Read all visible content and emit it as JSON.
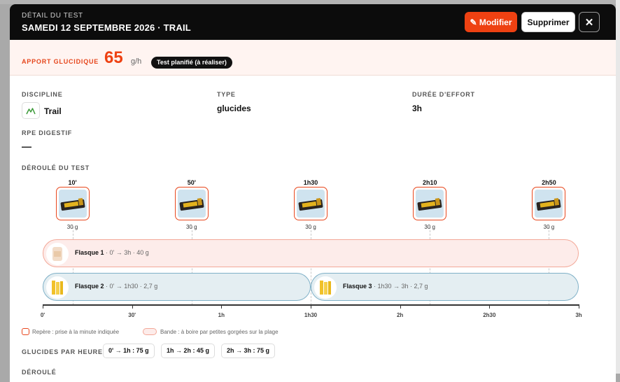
{
  "header": {
    "eyebrow": "DÉTAIL DU TEST",
    "title": "SAMEDI 12 SEPTEMBRE 2026 · TRAIL",
    "edit_label": "✎ Modifier",
    "delete_label": "Supprimer",
    "close_label": "✕"
  },
  "carb": {
    "label": "APPORT GLUCIDIQUE",
    "value": "65",
    "unit": "g/h",
    "status": "Test planifié (à réaliser)"
  },
  "fields": {
    "discipline_label": "DISCIPLINE",
    "discipline_value": "Trail",
    "type_label": "TYPE",
    "type_value": "glucides",
    "duration_label": "DURÉE D'EFFORT",
    "duration_value": "3h",
    "rpe_label": "RPE DIGESTIF",
    "rpe_value": "—"
  },
  "timeline": {
    "section_label": "DÉROULÉ DU TEST",
    "gels": [
      {
        "time": "10'",
        "minute": 10,
        "grams": "30 g"
      },
      {
        "time": "50'",
        "minute": 50,
        "grams": "30 g"
      },
      {
        "time": "1h30",
        "minute": 90,
        "grams": "30 g"
      },
      {
        "time": "2h10",
        "minute": 130,
        "grams": "30 g"
      },
      {
        "time": "2h50",
        "minute": 170,
        "grams": "30 g"
      }
    ],
    "flasks": [
      {
        "name": "Flasque 1",
        "detail": " · 0' → 3h · 40 g",
        "start": 0,
        "end": 180,
        "row": 0,
        "color": "pink"
      },
      {
        "name": "Flasque 2",
        "detail": " · 0' → 1h30 · 2,7 g",
        "start": 0,
        "end": 90,
        "row": 1,
        "color": "blue"
      },
      {
        "name": "Flasque 3",
        "detail": " · 1h30 → 3h · 2,7 g",
        "start": 90,
        "end": 180,
        "row": 1,
        "color": "blue"
      }
    ],
    "axis": [
      {
        "label": "0'",
        "minute": 0
      },
      {
        "label": "30'",
        "minute": 30
      },
      {
        "label": "1h",
        "minute": 60
      },
      {
        "label": "1h30",
        "minute": 90
      },
      {
        "label": "2h",
        "minute": 120
      },
      {
        "label": "2h30",
        "minute": 150
      },
      {
        "label": "3h",
        "minute": 180
      }
    ],
    "total_minutes": 180,
    "legend_marker": "Repère : prise à la minute indiquée",
    "legend_band": "Bande : à boire par petites gorgées sur la plage"
  },
  "per_hour": {
    "label": "GLUCIDES PAR HEURE",
    "chips": [
      "0' → 1h : 75 g",
      "1h → 2h : 45 g",
      "2h → 3h : 75 g"
    ]
  },
  "next_section_label": "DÉROULÉ",
  "colors": {
    "accent": "#ee4112",
    "header_bg": "#0c0c0c",
    "band_pink": "#fdecea",
    "band_blue": "#e4eef2"
  }
}
